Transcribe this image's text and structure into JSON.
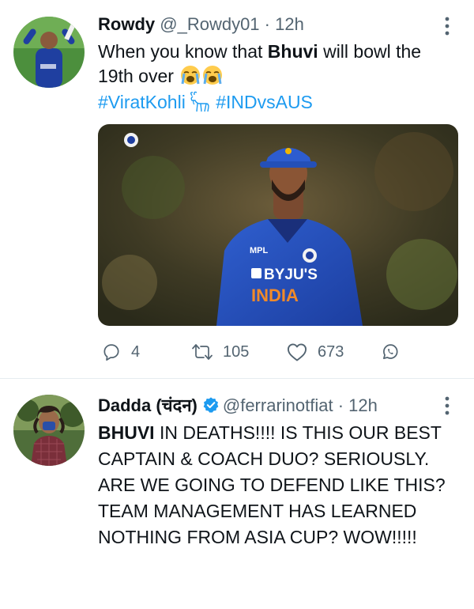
{
  "tweet1": {
    "name": "Rowdy",
    "handle": "@_Rowdy01",
    "separator": "·",
    "time": "12h",
    "text_pre": "When you know that ",
    "text_bold": "Bhuvi",
    "text_post": " will bowl the 19th over",
    "emoji": [
      "face-crying-loudly",
      "face-crying-loudly"
    ],
    "hashtags": [
      "#ViratKohli",
      "#INDvsAUS"
    ],
    "media": {
      "jersey_sponsor_top": "MPL",
      "jersey_sponsor": "BYJU'S",
      "jersey_team": "INDIA"
    },
    "actions": {
      "reply_count": "4",
      "retweet_count": "105",
      "like_count": "673"
    }
  },
  "tweet2": {
    "name": "Dadda (चंदन)",
    "verified": true,
    "handle": "@ferrarinotfiat",
    "separator": "·",
    "time": "12h",
    "text_bold": "BHUVI",
    "text_rest": " IN DEATHS!!!! IS THIS OUR BEST CAPTAIN & COACH DUO? SERIOUSLY. ARE WE GOING TO DEFEND LIKE THIS? TEAM MANAGEMENT HAS LEARNED NOTHING FROM ASIA CUP? WOW!!!!!"
  },
  "colors": {
    "link": "#1d9bf0",
    "meta": "#536471",
    "text": "#0f1419",
    "divider": "#e6ecf0"
  }
}
